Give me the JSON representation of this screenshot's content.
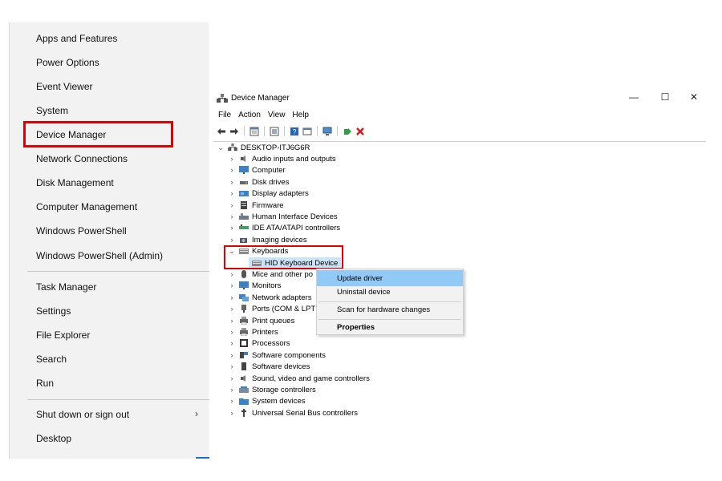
{
  "winx_menu": {
    "groups": [
      [
        "Apps and Features",
        "Power Options",
        "Event Viewer",
        "System",
        "Device Manager",
        "Network Connections",
        "Disk Management",
        "Computer Management",
        "Windows PowerShell",
        "Windows PowerShell (Admin)"
      ],
      [
        "Task Manager",
        "Settings",
        "File Explorer",
        "Search",
        "Run"
      ],
      [
        "Shut down or sign out",
        "Desktop"
      ]
    ],
    "highlighted": "Device Manager",
    "submenu_chevron": "›"
  },
  "device_manager": {
    "title": "Device Manager",
    "window_controls": {
      "minimize": "—",
      "maximize": "☐",
      "close": "✕"
    },
    "menu": [
      "File",
      "Action",
      "View",
      "Help"
    ],
    "root": "DESKTOP-ITJ6G6R",
    "tree": [
      {
        "label": "Audio inputs and outputs",
        "icon": "speaker-icon",
        "expanded": false
      },
      {
        "label": "Computer",
        "icon": "monitor-icon",
        "expanded": false
      },
      {
        "label": "Disk drives",
        "icon": "disk-icon",
        "expanded": false
      },
      {
        "label": "Display adapters",
        "icon": "display-adapter-icon",
        "expanded": false
      },
      {
        "label": "Firmware",
        "icon": "chip-icon",
        "expanded": false
      },
      {
        "label": "Human Interface Devices",
        "icon": "hid-icon",
        "expanded": false
      },
      {
        "label": "IDE ATA/ATAPI controllers",
        "icon": "ide-icon",
        "expanded": false
      },
      {
        "label": "Imaging devices",
        "icon": "camera-icon",
        "expanded": false
      },
      {
        "label": "Keyboards",
        "icon": "keyboard-icon",
        "expanded": true,
        "children": [
          "HID Keyboard Device"
        ]
      },
      {
        "label": "Mice and other po",
        "icon": "mouse-icon",
        "expanded": false
      },
      {
        "label": "Monitors",
        "icon": "monitor-icon",
        "expanded": false
      },
      {
        "label": "Network adapters",
        "icon": "network-icon",
        "expanded": false
      },
      {
        "label": "Ports (COM & LPT",
        "icon": "port-icon",
        "expanded": false
      },
      {
        "label": "Print queues",
        "icon": "printer-icon",
        "expanded": false
      },
      {
        "label": "Printers",
        "icon": "printer-icon",
        "expanded": false
      },
      {
        "label": "Processors",
        "icon": "processor-icon",
        "expanded": false
      },
      {
        "label": "Software components",
        "icon": "software-component-icon",
        "expanded": false
      },
      {
        "label": "Software devices",
        "icon": "software-device-icon",
        "expanded": false
      },
      {
        "label": "Sound, video and game controllers",
        "icon": "speaker-icon",
        "expanded": false
      },
      {
        "label": "Storage controllers",
        "icon": "storage-icon",
        "expanded": false
      },
      {
        "label": "System devices",
        "icon": "folder-icon",
        "expanded": false
      },
      {
        "label": "Universal Serial Bus controllers",
        "icon": "usb-icon",
        "expanded": false
      }
    ]
  },
  "context_menu": {
    "items": [
      "Update driver",
      "Uninstall device",
      "Scan for hardware changes",
      "Properties"
    ],
    "active": "Update driver",
    "bold": "Properties"
  },
  "colors": {
    "highlight_border": "#e00000",
    "selection": "#cce4f7",
    "context_hover": "#91c9f7",
    "accent": "#1b6fc2"
  }
}
